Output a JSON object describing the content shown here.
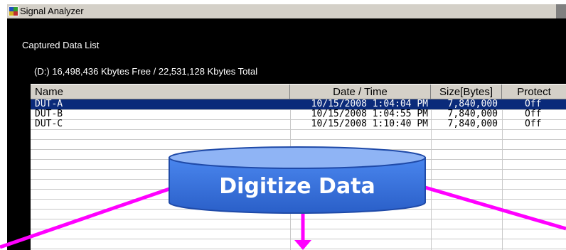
{
  "heading_fragment": "",
  "window": {
    "title": "Signal Analyzer"
  },
  "list": {
    "title": "Captured Data List",
    "disk_info": "(D:) 16,498,436 Kbytes Free / 22,531,128 Kbytes Total"
  },
  "table": {
    "columns": [
      "Name",
      "Date / Time",
      "Size[Bytes]",
      "Protect"
    ],
    "rows": [
      {
        "name": "DUT-A",
        "datetime": "10/15/2008 1:04:04 PM",
        "size": "7,840,000",
        "protect": "Off",
        "selected": true
      },
      {
        "name": "DUT-B",
        "datetime": "10/15/2008 1:04:55 PM",
        "size": "7,840,000",
        "protect": "Off",
        "selected": false
      },
      {
        "name": "DUT-C",
        "datetime": "10/15/2008 1:10:40 PM",
        "size": "7,840,000",
        "protect": "Off",
        "selected": false
      }
    ]
  },
  "overlay": {
    "cylinder_label": "Digitize Data",
    "cylinder_color": "#3b74e0",
    "arrow_color": "#ff00ff"
  }
}
